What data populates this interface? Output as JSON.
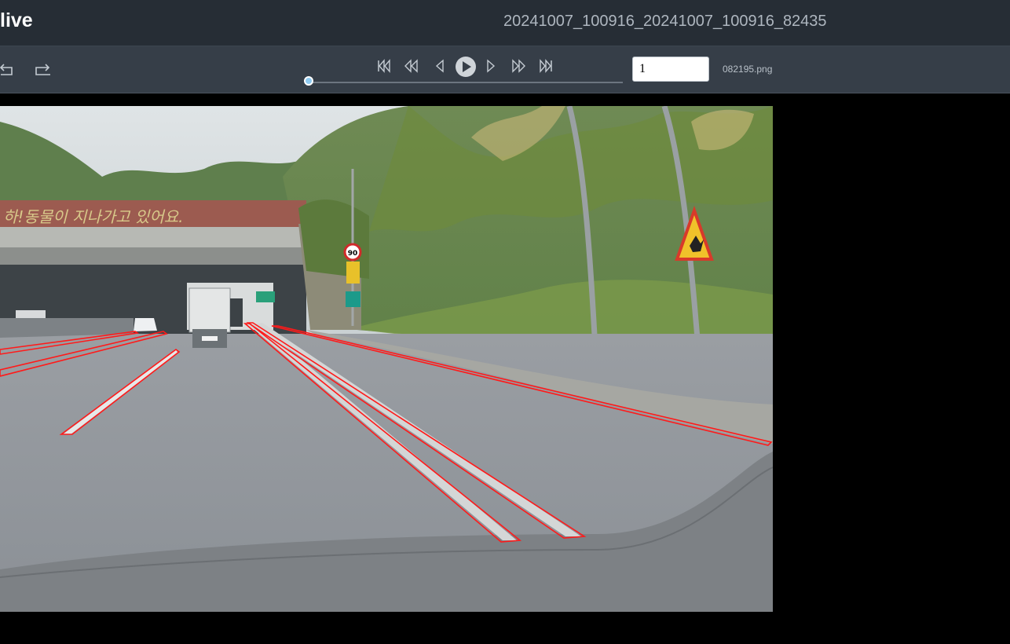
{
  "header": {
    "app_title": "live",
    "document_title": "20241007_100916_20241007_100916_82435"
  },
  "toolbar": {
    "frame_value": "1",
    "file_name": "082195.png",
    "playback_progress": 0
  },
  "scene": {
    "overpass_text": "하!동물이 지나가고 있어요.",
    "speed_limit": "90",
    "annotation_color": "#ff1a1a"
  }
}
